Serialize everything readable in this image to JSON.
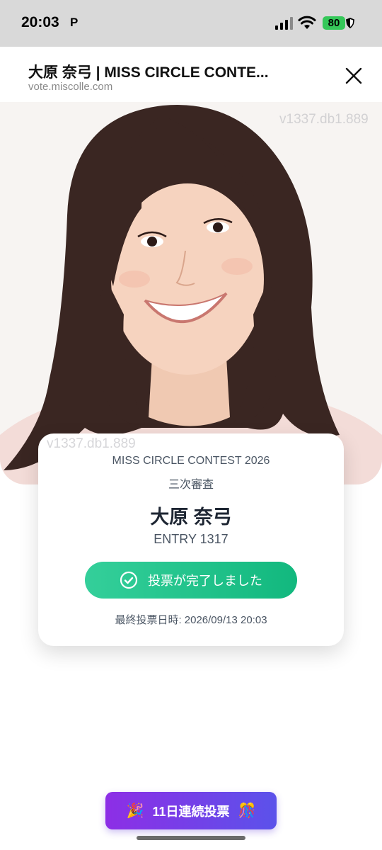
{
  "status": {
    "time": "20:03",
    "carrier_glyph": "P",
    "battery": "80",
    "icons": [
      "signal-icon",
      "wifi-icon",
      "battery-icon",
      "shield-icon"
    ]
  },
  "browser": {
    "title": "大原 奈弓 | MISS CIRCLE CONTE...",
    "url": "vote.miscolle.com",
    "close_icon": "close-icon"
  },
  "photo": {
    "watermark_top": "v1337.db1.889",
    "watermark_bottom": "v1337.db1.889"
  },
  "card": {
    "contest": "MISS CIRCLE CONTEST 2026",
    "round": "三次審査",
    "name": "大原 奈弓",
    "entry": "ENTRY 1317",
    "vote_status": "投票が完了しました",
    "last_vote": "最終投票日時: 2026/09/13 20:03"
  },
  "streak": {
    "label": "11日連続投票",
    "emoji_left": "🎉",
    "emoji_right": "🎊"
  },
  "colors": {
    "vote_button": "#1cbf85",
    "streak_button_start": "#8d2ee6",
    "streak_button_end": "#5b52ea",
    "battery": "#35c759"
  }
}
